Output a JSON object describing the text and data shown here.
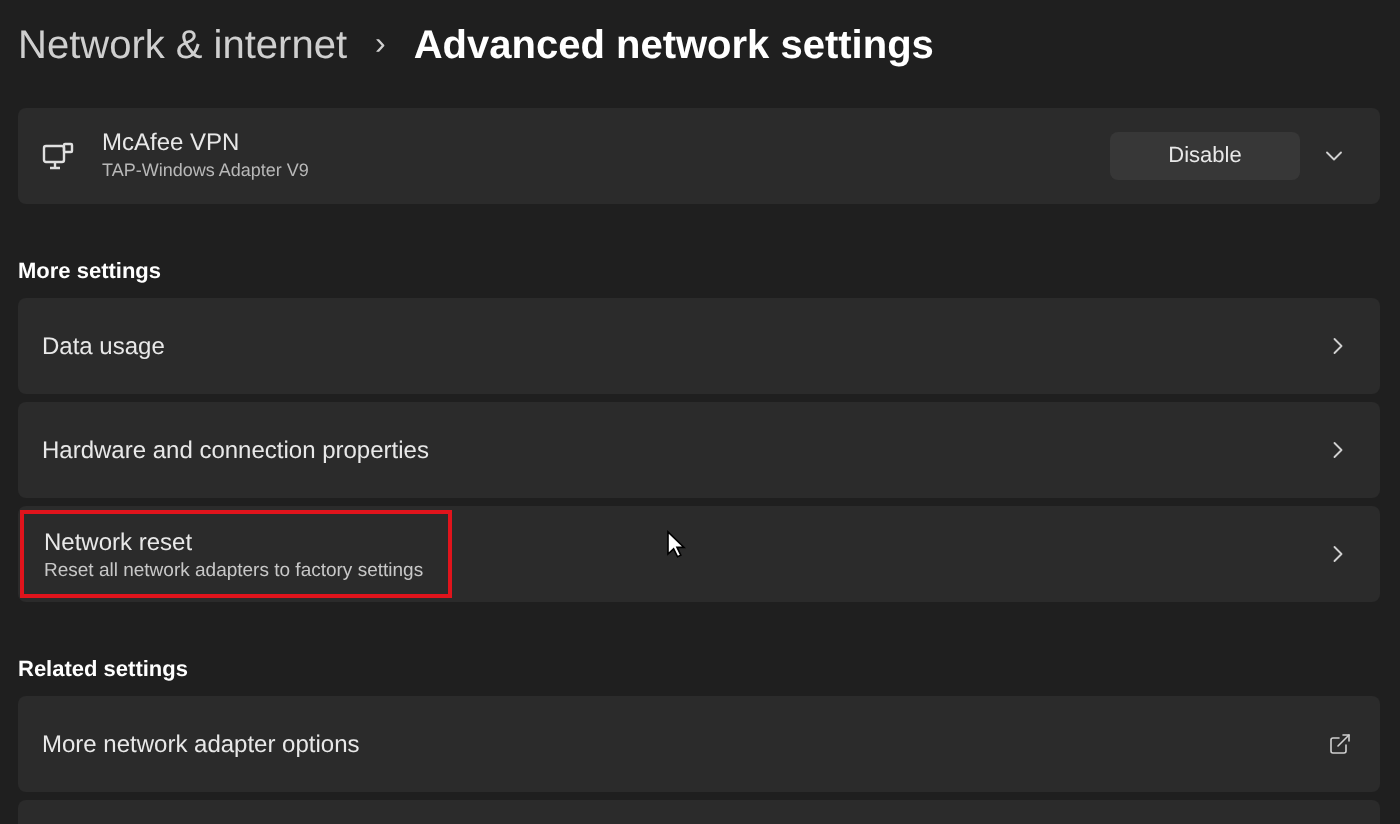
{
  "breadcrumb": {
    "parent": "Network & internet",
    "separator": "›",
    "current": "Advanced network settings"
  },
  "adapter": {
    "name": "McAfee VPN",
    "description": "TAP-Windows Adapter V9",
    "button": "Disable",
    "expanded": false
  },
  "sections": [
    {
      "heading": "More settings",
      "items": [
        {
          "kind": "link",
          "title": "Data usage",
          "highlighted": false
        },
        {
          "kind": "link",
          "title": "Hardware and connection properties",
          "highlighted": false
        },
        {
          "kind": "link",
          "title": "Network reset",
          "subtitle": "Reset all network adapters to factory settings",
          "highlighted": true
        }
      ]
    },
    {
      "heading": "Related settings",
      "items": [
        {
          "kind": "external",
          "title": "More network adapter options",
          "highlighted": false
        }
      ]
    }
  ]
}
